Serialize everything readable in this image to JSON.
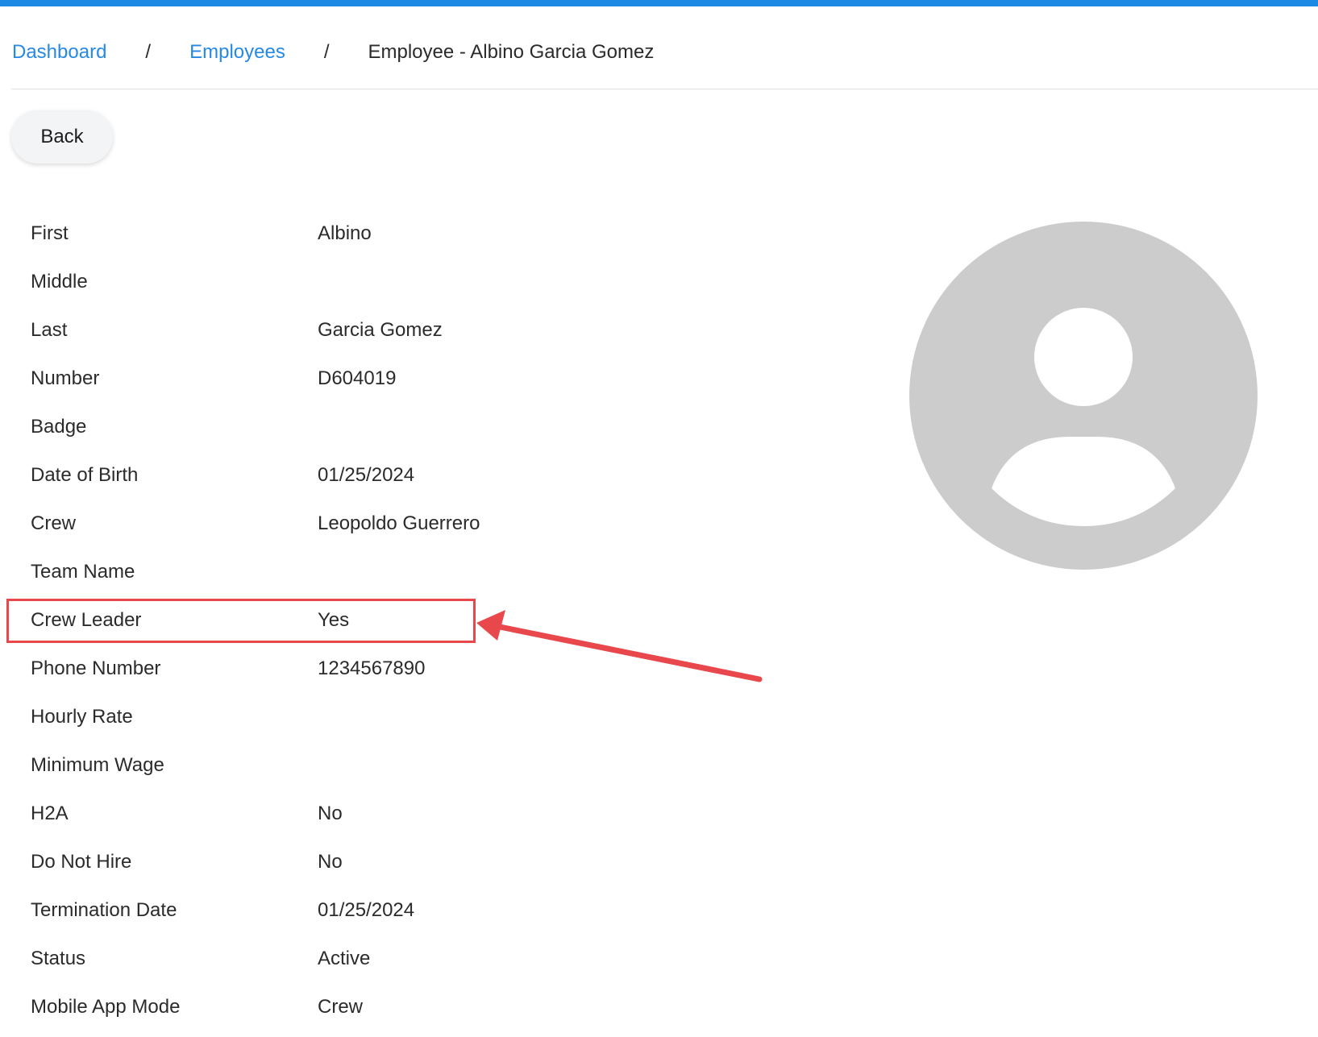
{
  "colors": {
    "accent": "#1e88e5",
    "link": "#2589e6",
    "annotation": "#e8474c",
    "avatar_bg": "#cccccc"
  },
  "breadcrumb": {
    "items": [
      {
        "label": "Dashboard"
      },
      {
        "label": "Employees"
      }
    ],
    "separator": "/",
    "current": "Employee - Albino Garcia Gomez"
  },
  "back_button": {
    "label": "Back"
  },
  "fields": [
    {
      "label": "First",
      "value": "Albino"
    },
    {
      "label": "Middle",
      "value": ""
    },
    {
      "label": "Last",
      "value": "Garcia Gomez"
    },
    {
      "label": "Number",
      "value": "D604019"
    },
    {
      "label": "Badge",
      "value": ""
    },
    {
      "label": "Date of Birth",
      "value": "01/25/2024"
    },
    {
      "label": "Crew",
      "value": "Leopoldo Guerrero"
    },
    {
      "label": "Team Name",
      "value": ""
    },
    {
      "label": "Crew Leader",
      "value": "Yes"
    },
    {
      "label": "Phone Number",
      "value": "1234567890"
    },
    {
      "label": "Hourly Rate",
      "value": ""
    },
    {
      "label": "Minimum Wage",
      "value": ""
    },
    {
      "label": "H2A",
      "value": "No"
    },
    {
      "label": "Do Not Hire",
      "value": "No"
    },
    {
      "label": "Termination Date",
      "value": "01/25/2024"
    },
    {
      "label": "Status",
      "value": "Active"
    },
    {
      "label": "Mobile App Mode",
      "value": "Crew"
    }
  ],
  "avatar": {
    "icon": "user-avatar-icon"
  },
  "annotation": {
    "icon": "arrow-icon",
    "highlighted_field": "Crew Leader"
  }
}
